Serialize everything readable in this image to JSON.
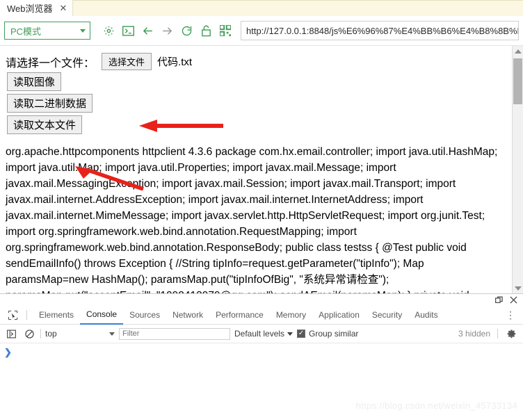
{
  "browser": {
    "tab": {
      "title": "Web浏览器",
      "close_icon": "close-icon"
    },
    "toolbar": {
      "mode_value": "PC模式",
      "icons": [
        "gear-icon",
        "console-icon",
        "back-arrow-icon",
        "forward-arrow-icon",
        "reload-icon",
        "unlock-icon",
        "qrcode-icon"
      ],
      "url": "http://127.0.0.1:8848/js%E6%96%87%E4%BB%B6%E4%B8%8B%E8",
      "accent_color": "#3f9e56"
    }
  },
  "page": {
    "file_prompt": "请选择一个文件：",
    "choose_file_button": "选择文件",
    "selected_file": "代码.txt",
    "buttons": [
      {
        "label": "读取图像"
      },
      {
        "label": "读取二进制数据"
      },
      {
        "label": "读取文本文件"
      }
    ],
    "content": "org.apache.httpcomponents httpclient 4.3.6 package com.hx.email.controller; import java.util.HashMap; import java.util.Map; import java.util.Properties; import javax.mail.Message; import javax.mail.MessagingException; import javax.mail.Session; import javax.mail.Transport; import javax.mail.internet.AddressException; import javax.mail.internet.InternetAddress; import javax.mail.internet.MimeMessage; import javax.servlet.http.HttpServletRequest; import org.junit.Test; import org.springframework.web.bind.annotation.RequestMapping; import org.springframework.web.bind.annotation.ResponseBody; public class testss { @Test public void sendEmailInfo() throws Exception { //String tipInfo=request.getParameter(\"tipInfo\"); Map paramsMap=new HashMap(); paramsMap.put(\"tipInfoOfBig\", \"系统异常请检查\"); paramsMap.put(\"acceptEmail\", \"1092413979@qq.com\"); sendAEmail(paramsMap); } private void sendAEmail(Map paramsMap) { // TODO 自动生成的方法存根 String",
    "annotation_arrows": [
      {
        "name": "arrow-to-filename",
        "color": "#e8221a",
        "direction": "left"
      },
      {
        "name": "arrow-to-read-text-button",
        "color": "#e8221a",
        "direction": "up-left"
      }
    ],
    "scrollbar": {
      "up_icon": "scroll-up-arrow-icon",
      "down_icon": "scroll-down-arrow-icon"
    }
  },
  "devtools": {
    "window_controls": [
      "dock-icon",
      "close-icon"
    ],
    "inspect_icon": "inspect-element-icon",
    "tabs": [
      {
        "label": "Elements",
        "active": false
      },
      {
        "label": "Console",
        "active": true
      },
      {
        "label": "Sources",
        "active": false
      },
      {
        "label": "Network",
        "active": false
      },
      {
        "label": "Performance",
        "active": false
      },
      {
        "label": "Memory",
        "active": false
      },
      {
        "label": "Application",
        "active": false
      },
      {
        "label": "Security",
        "active": false
      },
      {
        "label": "Audits",
        "active": false
      }
    ],
    "more_icon": "kebab-menu-icon",
    "filterbar": {
      "sidebar_icon": "show-console-sidebar-icon",
      "clear_icon": "clear-console-icon",
      "context": "top",
      "filter_placeholder": "Filter",
      "filter_value": "",
      "levels_label": "Default levels",
      "group_similar_label": "Group similar",
      "group_similar_checked": true,
      "hidden_label": "3 hidden",
      "settings_icon": "gear-icon"
    },
    "prompt_symbol": "❯"
  },
  "watermark": "https://blog.csdn.net/weixin_45733134"
}
